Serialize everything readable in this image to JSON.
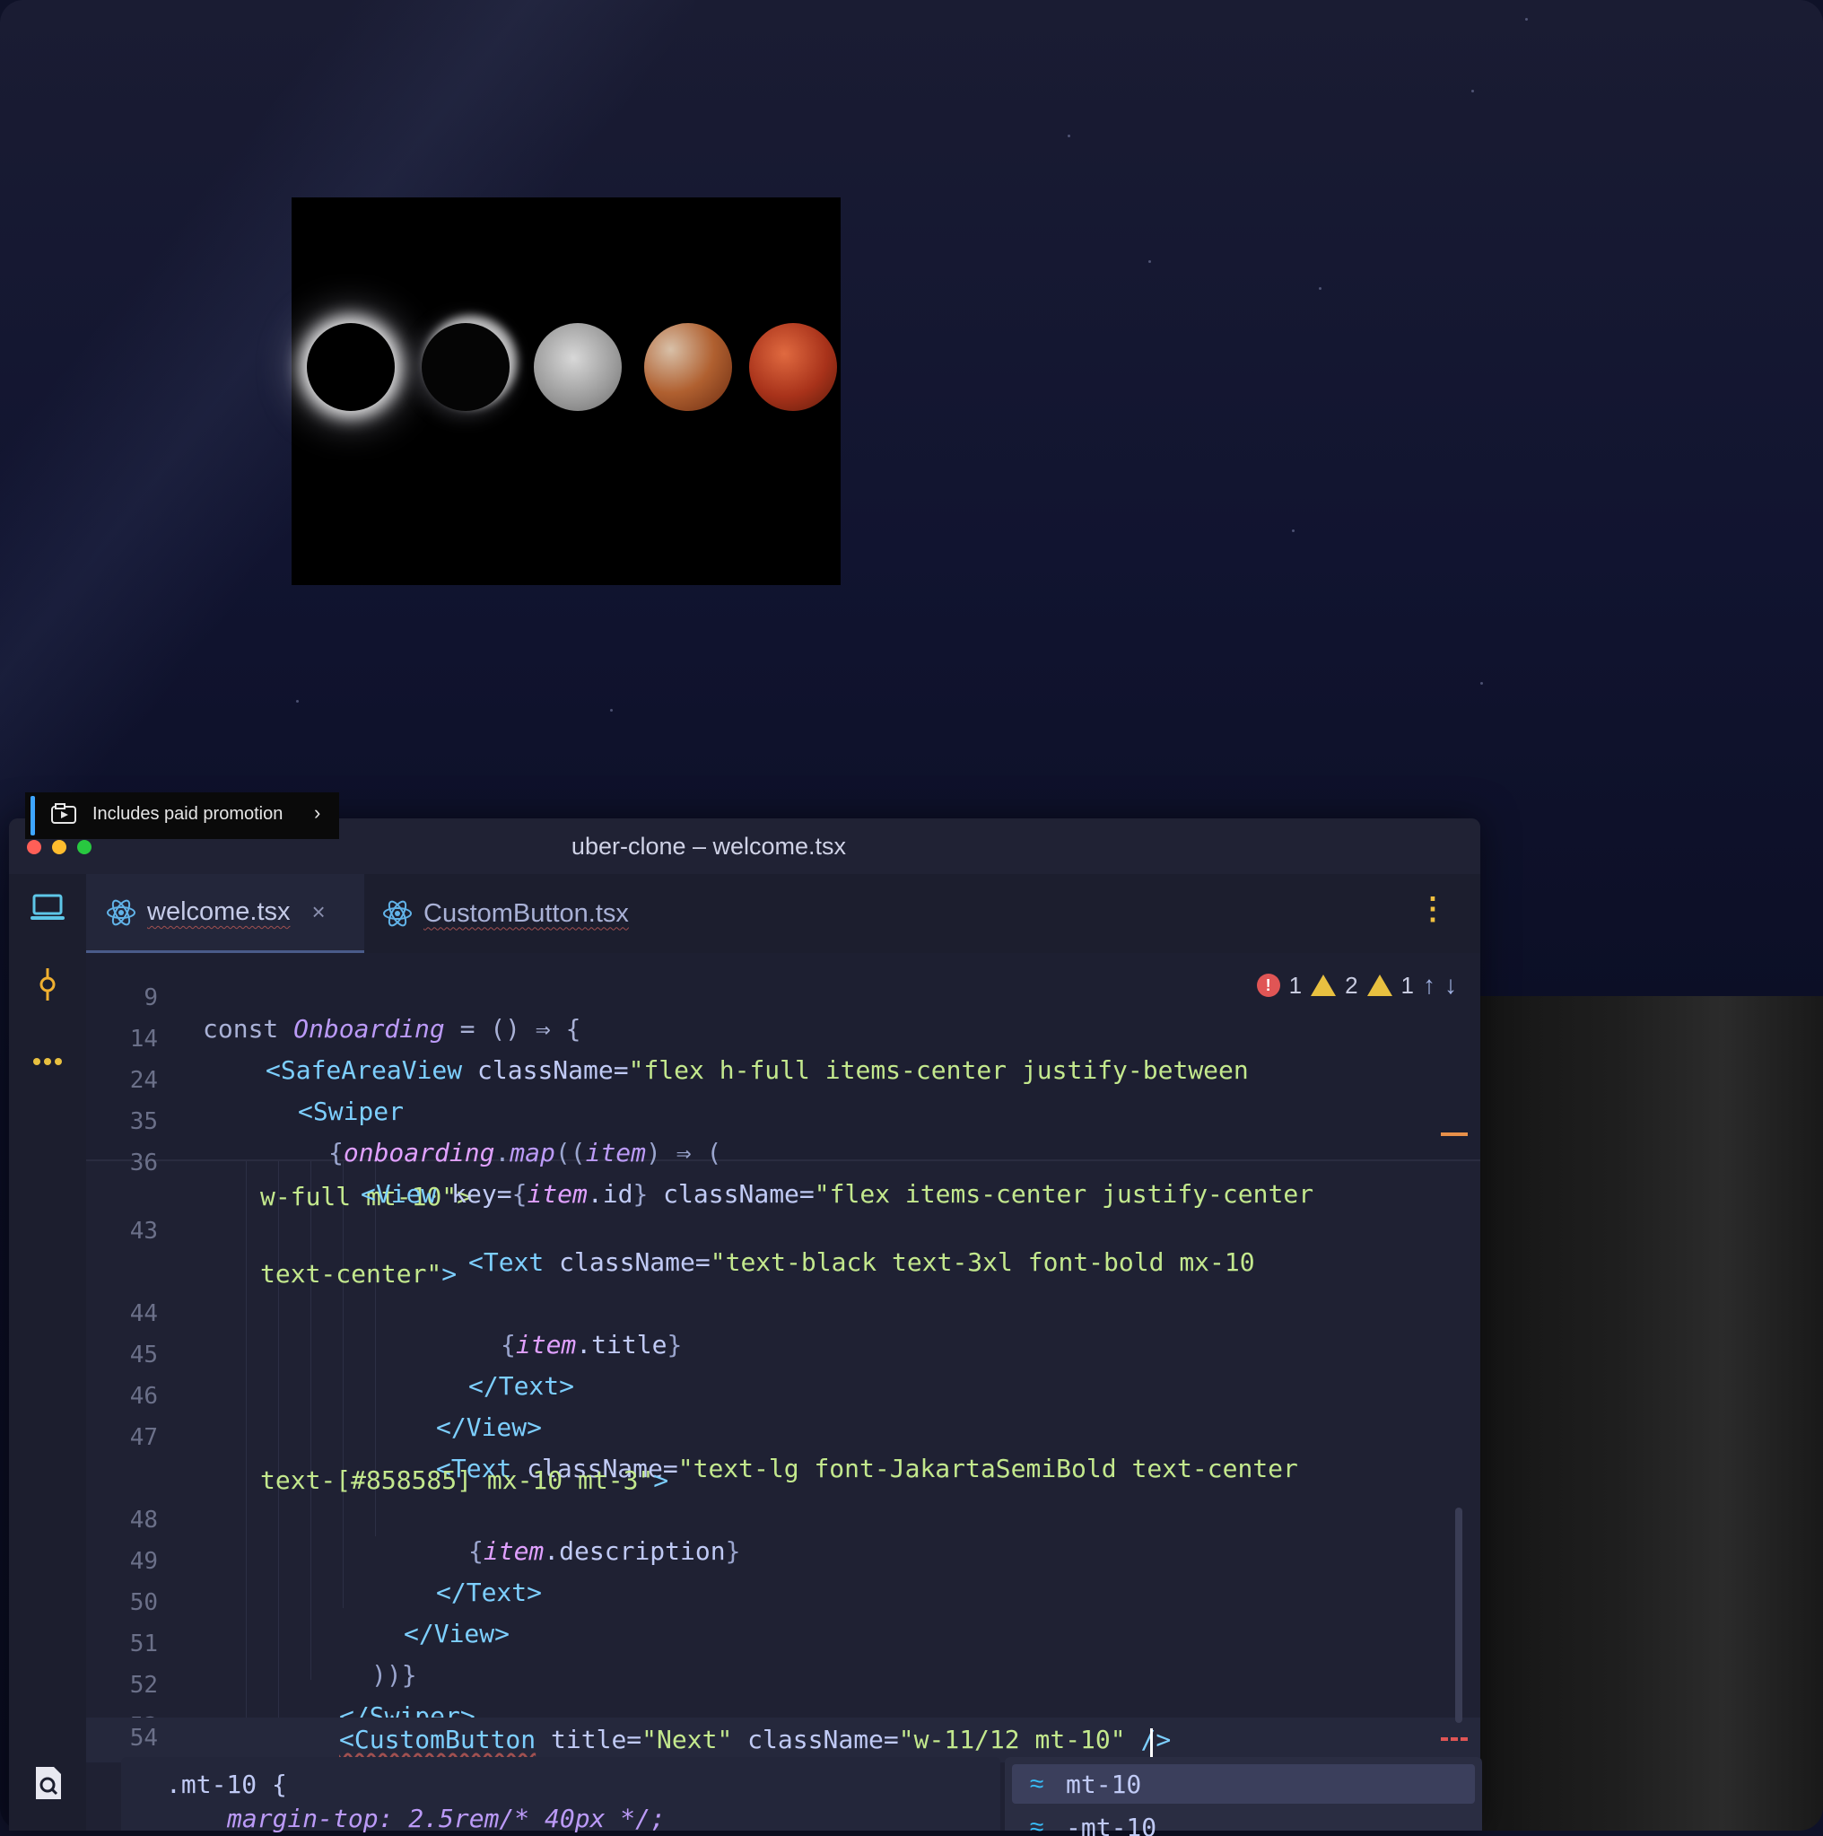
{
  "promo": {
    "text": "Includes paid promotion",
    "chevron": "›"
  },
  "window": {
    "title": "uber-clone – welcome.tsx"
  },
  "tabs": [
    {
      "label": "welcome.tsx",
      "close": "×",
      "active": true
    },
    {
      "label": "CustomButton.tsx",
      "active": false
    }
  ],
  "problems": {
    "errors": "1",
    "warnings": "2",
    "weak_warnings": "1",
    "up": "↑",
    "down": "↓"
  },
  "sticky_lines": [
    {
      "num": "9"
    },
    {
      "num": "14"
    },
    {
      "num": "24"
    },
    {
      "num": "35"
    },
    {
      "num": "36"
    }
  ],
  "code_lines": [
    {
      "num": "43"
    },
    {
      "num": "44"
    },
    {
      "num": "45"
    },
    {
      "num": "46"
    },
    {
      "num": "47"
    },
    {
      "num": "48"
    },
    {
      "num": "49"
    },
    {
      "num": "50"
    },
    {
      "num": "51"
    },
    {
      "num": "52"
    },
    {
      "num": "53"
    },
    {
      "num": "54"
    }
  ],
  "code_text": {
    "l9_const": "const ",
    "l9_name": "Onboarding",
    "l9_rest": " = () ⇒ {",
    "l14_tag": "<SafeAreaView",
    "l14_attr": " className=",
    "l14_str": "\"flex h-full items-center justify-between",
    "l24_tag": "<Swiper",
    "l35_open": "{",
    "l35_obj": "onboarding",
    "l35_dot": ".",
    "l35_map": "map",
    "l35_args_open": "((",
    "l35_item": "item",
    "l35_rest": ") ⇒ (",
    "l36_tag": "<View",
    "l36_key": " key=",
    "l36_brace1": "{",
    "l36_item": "item",
    "l36_id": ".id",
    "l36_brace2": "}",
    "l36_attr": " className=",
    "l36_str": "\"flex items-center justify-center",
    "l_partial": "w-full mt-10\">",
    "l43_tag": "<Text",
    "l43_attr": " className=",
    "l43_str": "\"text-black text-3xl font-bold mx-10",
    "l43b_str": "text-center\"",
    "l43b_end": ">",
    "l44_open": "{",
    "l44_item": "item",
    "l44_prop": ".title",
    "l44_close": "}",
    "l45": "</Text>",
    "l46": "</View>",
    "l47_tag": "<Text",
    "l47_attr": " className=",
    "l47_str": "\"text-lg font-JakartaSemiBold text-center",
    "l47b_str": "text-[#858585] mx-10 mt-3\"",
    "l47b_end": ">",
    "l48_open": "{",
    "l48_item": "item",
    "l48_prop": ".description",
    "l48_close": "}",
    "l49": "</Text>",
    "l50": "</View>",
    "l51": "))}",
    "l52": "</Swiper>",
    "l54_tag": "<CustomButton",
    "l54_attr1": " title=",
    "l54_str1": "\"Next\"",
    "l54_attr2": " className=",
    "l54_str2": "\"w-11/12 mt-10\"",
    "l54_end": " />"
  },
  "doc_popup": {
    "selector": ".mt-10 {",
    "property": "margin-top: 2.5rem/* 40px */;"
  },
  "suggestions": {
    "item1": "mt-10",
    "item2": "-mt-10"
  },
  "colors": {
    "accent": "#3ea6ff",
    "error": "#e05555",
    "warning": "#e8c040"
  }
}
